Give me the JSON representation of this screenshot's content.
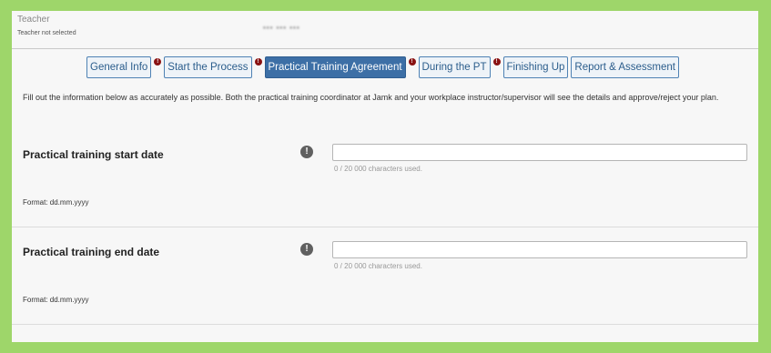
{
  "teacher": {
    "label": "Teacher",
    "status": "Teacher not selected",
    "name_blurred": "••• ••• •••"
  },
  "tabs": [
    {
      "label": "General Info",
      "active": false,
      "warning": true
    },
    {
      "label": "Start the Process",
      "active": false,
      "warning": true
    },
    {
      "label": "Practical Training Agreement",
      "active": true,
      "warning": true
    },
    {
      "label": "During the PT",
      "active": false,
      "warning": true
    },
    {
      "label": "Finishing Up",
      "active": false,
      "warning": false
    },
    {
      "label": "Report & Assessment",
      "active": false,
      "warning": false
    }
  ],
  "warning_glyph": "!",
  "intro": "Fill out the information below as accurately as possible. Both the practical training coordinator at Jamk and your workplace instructor/supervisor will see the details and approve/reject your plan.",
  "fields": [
    {
      "label": "Practical training start date",
      "value": "",
      "char_count": "0 / 20 000 characters used.",
      "format": "Format: dd.mm.yyyy",
      "info_icon": "exclamation-circle-icon"
    },
    {
      "label": "Practical training end date",
      "value": "",
      "char_count": "0 / 20 000 characters used.",
      "format": "Format: dd.mm.yyyy",
      "info_icon": "exclamation-circle-icon"
    }
  ],
  "colors": {
    "outer_border": "#9ed66a",
    "tab_border": "#4f82b4",
    "tab_active_bg": "#3d6fa6",
    "warning_dot": "#8a1212"
  }
}
